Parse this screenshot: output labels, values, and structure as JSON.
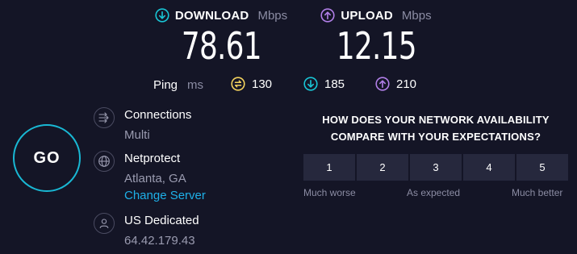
{
  "download": {
    "label": "DOWNLOAD",
    "unit": "Mbps",
    "value": "78.61",
    "icon": "arrow-down-circle-icon",
    "color": "#19c6d6"
  },
  "upload": {
    "label": "UPLOAD",
    "unit": "Mbps",
    "value": "12.15",
    "icon": "arrow-up-circle-icon",
    "color": "#b17fe8"
  },
  "ping": {
    "label": "Ping",
    "unit": "ms",
    "idle": {
      "value": "130",
      "icon": "ping-idle-icon",
      "color": "#f4d35e"
    },
    "download": {
      "value": "185",
      "icon": "arrow-down-circle-icon",
      "color": "#19c6d6"
    },
    "upload": {
      "value": "210",
      "icon": "arrow-up-circle-icon",
      "color": "#b17fe8"
    }
  },
  "go_button": {
    "label": "GO",
    "color": "#19b8d4"
  },
  "connections": {
    "title": "Connections",
    "value": "Multi",
    "icon": "connections-icon"
  },
  "server": {
    "name": "Netprotect",
    "location": "Atlanta, GA",
    "change_label": "Change Server",
    "icon": "globe-icon"
  },
  "provider": {
    "name": "US Dedicated",
    "ip": "64.42.179.43",
    "icon": "user-icon"
  },
  "survey": {
    "question_line1": "HOW DOES YOUR NETWORK AVAILABILITY",
    "question_line2": "COMPARE WITH YOUR EXPECTATIONS?",
    "options": [
      "1",
      "2",
      "3",
      "4",
      "5"
    ],
    "caption_low": "Much worse",
    "caption_mid": "As expected",
    "caption_high": "Much better"
  }
}
